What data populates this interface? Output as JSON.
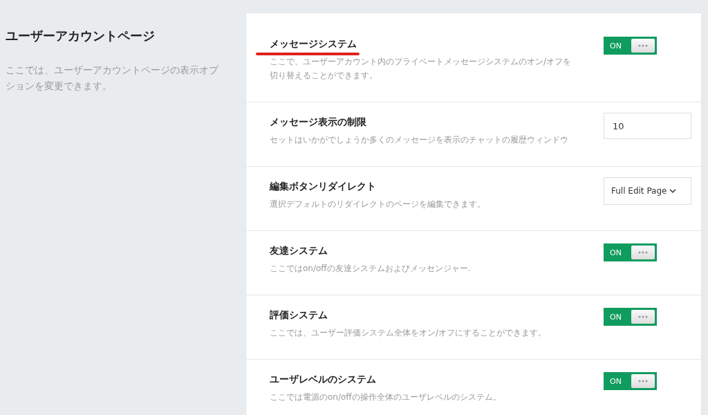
{
  "section": {
    "title": "ユーザーアカウントページ",
    "description": "ここでは、ユーザーアカウントページの表示オプションを変更できます。"
  },
  "settings": [
    {
      "kind": "toggle",
      "title": "メッセージシステム",
      "underlined": true,
      "description": "ここで、ユーザーアカウント内のプライベートメッセージシステムのオン/オフを切り替えることができます。",
      "on": true,
      "label": "ON"
    },
    {
      "kind": "number",
      "title": "メッセージ表示の制限",
      "underlined": false,
      "description": "セットはいかがでしょうか多くのメッセージを表示のチャットの履歴ウィンドウ",
      "value": "10"
    },
    {
      "kind": "select",
      "title": "編集ボタンリダイレクト",
      "underlined": false,
      "description": "選択デフォルトのリダイレクトのページを編集できます。",
      "value": "Full Edit Page"
    },
    {
      "kind": "toggle",
      "title": "友達システム",
      "underlined": false,
      "description": "ここではon/offの友達システムおよびメッセンジャー.",
      "on": true,
      "label": "ON"
    },
    {
      "kind": "toggle",
      "title": "評価システム",
      "underlined": false,
      "description": "ここでは、ユーザー評価システム全体をオン/オフにすることができます。",
      "on": true,
      "label": "ON"
    },
    {
      "kind": "toggle",
      "title": "ユーザレベルのシステム",
      "underlined": false,
      "description": "ここでは電源のon/offの操作全体のユーザレベルのシステム。",
      "on": true,
      "label": "ON"
    }
  ]
}
